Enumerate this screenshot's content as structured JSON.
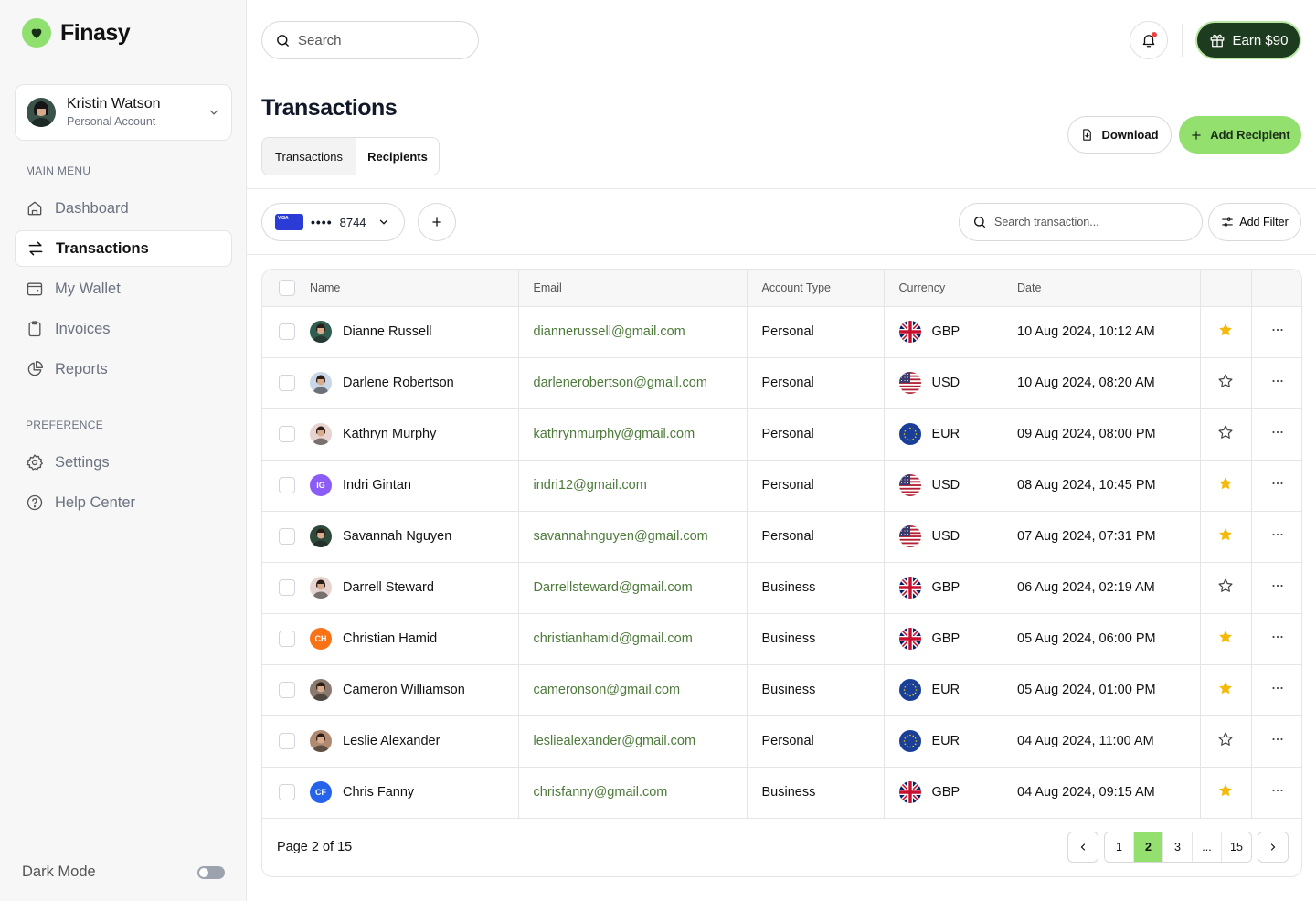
{
  "brand": {
    "name": "Finasy",
    "accent": "#93e06e",
    "dark": "#1d3b1e"
  },
  "account": {
    "name": "Kristin Watson",
    "type": "Personal Account"
  },
  "sidebar": {
    "main_label": "MAIN MENU",
    "main_items": [
      {
        "label": "Dashboard",
        "icon": "home-icon"
      },
      {
        "label": "Transactions",
        "icon": "swap-icon",
        "active": true
      },
      {
        "label": "My Wallet",
        "icon": "wallet-icon"
      },
      {
        "label": "Invoices",
        "icon": "clipboard-icon"
      },
      {
        "label": "Reports",
        "icon": "pie-chart-icon"
      }
    ],
    "pref_label": "PREFERENCE",
    "pref_items": [
      {
        "label": "Settings",
        "icon": "gear-icon"
      },
      {
        "label": "Help Center",
        "icon": "help-icon"
      }
    ],
    "dark_mode_label": "Dark Mode",
    "dark_mode_on": false
  },
  "header": {
    "search_placeholder": "Search",
    "earn_label": "Earn $90"
  },
  "page": {
    "title": "Transactions",
    "tabs": [
      "Transactions",
      "Recipients"
    ],
    "download_label": "Download",
    "add_recipient_label": "Add Recipient"
  },
  "toolbar": {
    "card_brand": "VISA",
    "card_mask": "••••",
    "card_last4": "8744",
    "search_placeholder": "Search transaction...",
    "filter_label": "Add Filter"
  },
  "table": {
    "columns": [
      "Name",
      "Email",
      "Account Type",
      "Currency",
      "Date"
    ],
    "rows": [
      {
        "name": "Dianne Russell",
        "email": "diannerussell@gmail.com",
        "type": "Personal",
        "currency": "GBP",
        "date": "10 Aug 2024, 10:12 AM",
        "starred": true,
        "avatar": {
          "kind": "photo",
          "color": "#2f5d50"
        }
      },
      {
        "name": "Darlene Robertson",
        "email": "darlenerobertson@gmail.com",
        "type": "Personal",
        "currency": "USD",
        "date": "10 Aug 2024, 08:20 AM",
        "starred": false,
        "avatar": {
          "kind": "photo",
          "color": "#c9d6e8"
        }
      },
      {
        "name": "Kathryn Murphy",
        "email": "kathrynmurphy@gmail.com",
        "type": "Personal",
        "currency": "EUR",
        "date": "09 Aug 2024, 08:00 PM",
        "starred": false,
        "avatar": {
          "kind": "photo",
          "color": "#e8d3d0"
        }
      },
      {
        "name": "Indri Gintan",
        "email": "indri12@gmail.com",
        "type": "Personal",
        "currency": "USD",
        "date": "08 Aug 2024, 10:45 PM",
        "starred": true,
        "avatar": {
          "kind": "initials",
          "text": "IG",
          "color": "#8b5cf6"
        }
      },
      {
        "name": "Savannah Nguyen",
        "email": "savannahnguyen@gmail.com",
        "type": "Personal",
        "currency": "USD",
        "date": "07 Aug 2024, 07:31 PM",
        "starred": true,
        "avatar": {
          "kind": "photo",
          "color": "#2e4a3a"
        }
      },
      {
        "name": "Darrell Steward",
        "email": "Darrellsteward@gmail.com",
        "type": "Business",
        "currency": "GBP",
        "date": "06 Aug 2024, 02:19 AM",
        "starred": false,
        "avatar": {
          "kind": "photo",
          "color": "#e5d4d0"
        }
      },
      {
        "name": "Christian Hamid",
        "email": "christianhamid@gmail.com",
        "type": "Business",
        "currency": "GBP",
        "date": "05 Aug 2024, 06:00 PM",
        "starred": true,
        "avatar": {
          "kind": "initials",
          "text": "CH",
          "color": "#f97316"
        }
      },
      {
        "name": "Cameron Williamson",
        "email": "cameronson@gmail.com",
        "type": "Business",
        "currency": "EUR",
        "date": "05 Aug 2024, 01:00 PM",
        "starred": true,
        "avatar": {
          "kind": "photo",
          "color": "#8a7a6e"
        }
      },
      {
        "name": "Leslie Alexander",
        "email": "lesliealexander@gmail.com",
        "type": "Personal",
        "currency": "EUR",
        "date": "04 Aug 2024, 11:00 AM",
        "starred": false,
        "avatar": {
          "kind": "photo",
          "color": "#b08a70"
        }
      },
      {
        "name": "Chris Fanny",
        "email": "chrisfanny@gmail.com",
        "type": "Business",
        "currency": "GBP",
        "date": "04 Aug 2024, 09:15 AM",
        "starred": true,
        "avatar": {
          "kind": "initials",
          "text": "CF",
          "color": "#2563eb"
        }
      }
    ]
  },
  "pagination": {
    "info": "Page 2 of 15",
    "pages": [
      "1",
      "2",
      "3",
      "...",
      "15"
    ],
    "current": "2"
  },
  "colors": {
    "star": "#f5b90b",
    "email": "#4d7a3a"
  }
}
